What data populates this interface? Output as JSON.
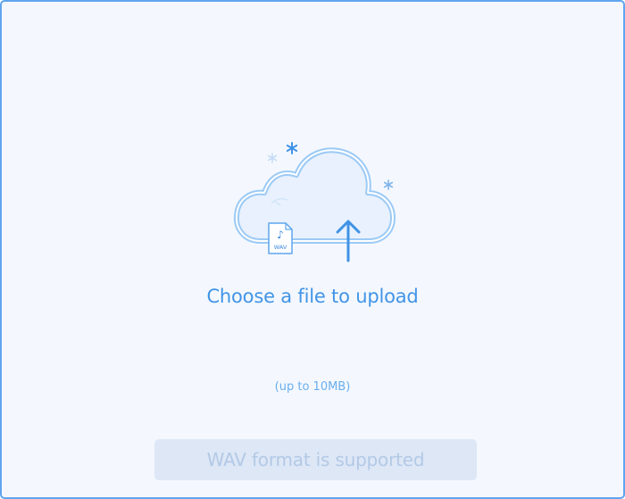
{
  "upload": {
    "title": "Choose a file to upload",
    "size_limit": "(up to 10MB)",
    "format_note": "WAV format is supported",
    "file_badge_text": "WAV"
  },
  "icons": {
    "cloud": "cloud-upload-icon",
    "file": "wav-file-icon",
    "arrow": "upload-arrow-icon",
    "sparkles": [
      "snowflake-icon",
      "snowflake-icon",
      "snowflake-icon"
    ]
  },
  "colors": {
    "border": "#5fa5ee",
    "background": "#f4f8fe",
    "accent": "#4194e6",
    "subtle_text": "#6aaeee",
    "badge_bg": "#dde7f6",
    "badge_text": "#b3c9e6"
  }
}
